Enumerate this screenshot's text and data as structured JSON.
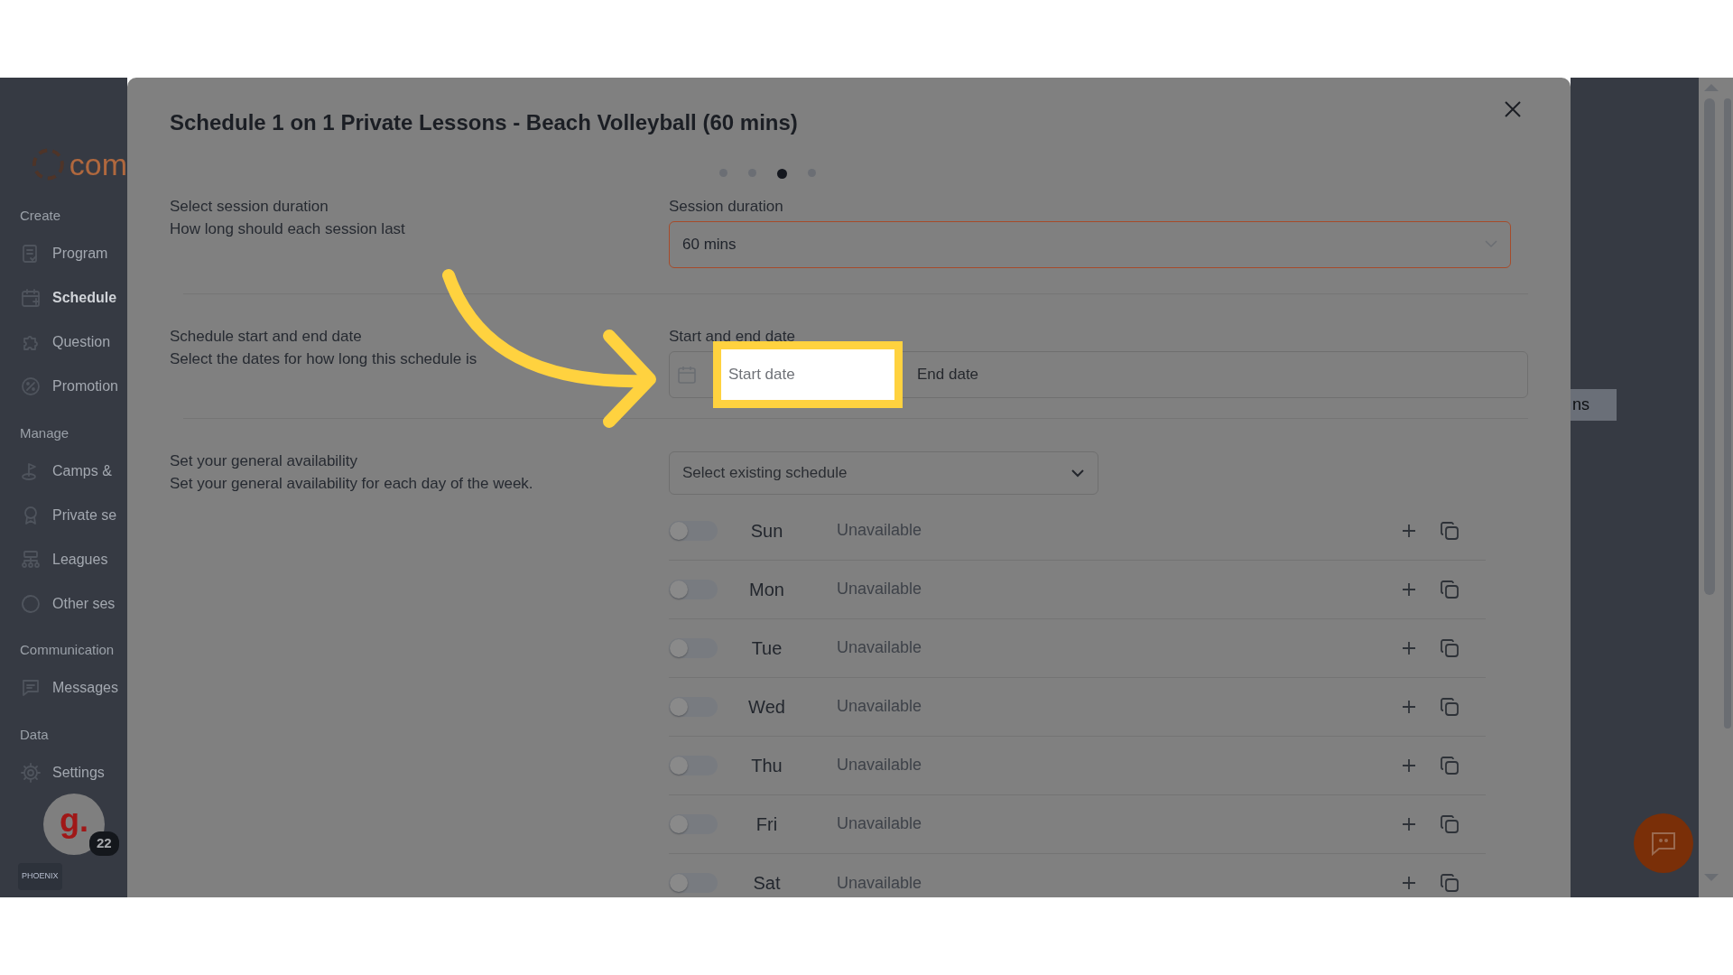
{
  "sidebar": {
    "logo_text": "com",
    "sections": [
      {
        "heading": "Create",
        "items": [
          {
            "label": "Program",
            "selected": false
          },
          {
            "label": "Schedule",
            "selected": true
          },
          {
            "label": "Question",
            "selected": false
          },
          {
            "label": "Promotion",
            "selected": false
          }
        ]
      },
      {
        "heading": "Manage",
        "items": [
          {
            "label": "Camps &",
            "selected": false
          },
          {
            "label": "Private se",
            "selected": false
          },
          {
            "label": "Leagues",
            "selected": false
          },
          {
            "label": "Other ses",
            "selected": false
          }
        ]
      },
      {
        "heading": "Communication",
        "items": [
          {
            "label": "Messages",
            "selected": false
          }
        ]
      },
      {
        "heading": "Data",
        "items": [
          {
            "label": "Settings",
            "selected": false
          }
        ]
      }
    ],
    "avatar": {
      "letter": "g.",
      "badge": "22"
    },
    "org_logo": "PHOENIX"
  },
  "background_text": "ns",
  "modal": {
    "title": "Schedule 1 on 1 Private Lessons - Beach Volleyball (60 mins)",
    "steps": [
      {
        "selected": false
      },
      {
        "selected": false
      },
      {
        "selected": true
      },
      {
        "selected": false
      }
    ],
    "duration": {
      "label": "Select session duration",
      "description": "How long should each session last",
      "field_label": "Session duration",
      "value": "60 mins"
    },
    "dates": {
      "label": "Schedule start and end date",
      "description": "Select the dates for how long this schedule is",
      "field_label": "Start and end date",
      "start_placeholder": "Start date",
      "end_placeholder": "End date"
    },
    "availability": {
      "label": "Set your general availability",
      "description": "Set your general availability for each day of the week.",
      "select_placeholder": "Select existing schedule",
      "days": [
        {
          "day": "Sun",
          "status": "Unavailable",
          "on": false
        },
        {
          "day": "Mon",
          "status": "Unavailable",
          "on": false
        },
        {
          "day": "Tue",
          "status": "Unavailable",
          "on": false
        },
        {
          "day": "Wed",
          "status": "Unavailable",
          "on": false
        },
        {
          "day": "Thu",
          "status": "Unavailable",
          "on": false
        },
        {
          "day": "Fri",
          "status": "Unavailable",
          "on": false
        },
        {
          "day": "Sat",
          "status": "Unavailable",
          "on": false
        }
      ]
    }
  }
}
